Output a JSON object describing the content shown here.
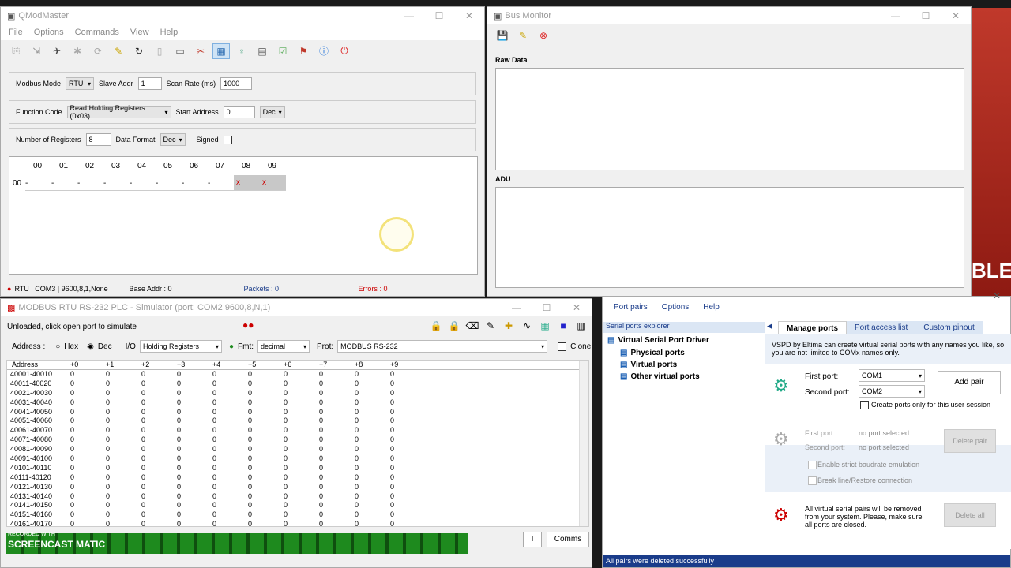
{
  "qmod": {
    "title": "QModMaster",
    "menu": [
      "File",
      "Options",
      "Commands",
      "View",
      "Help"
    ],
    "modbus_mode_label": "Modbus Mode",
    "modbus_mode": "RTU",
    "slave_addr_label": "Slave Addr",
    "slave_addr": "1",
    "scan_rate_label": "Scan Rate (ms)",
    "scan_rate": "1000",
    "function_code_label": "Function Code",
    "function_code": "Read Holding Registers (0x03)",
    "start_address_label": "Start Address",
    "start_address": "0",
    "start_format": "Dec",
    "num_regs_label": "Number of Registers",
    "num_regs": "8",
    "data_format_label": "Data Format",
    "data_format": "Dec",
    "signed_label": "Signed",
    "columns": [
      "00",
      "01",
      "02",
      "03",
      "04",
      "05",
      "06",
      "07",
      "08",
      "09"
    ],
    "row_label": "00",
    "values": [
      "-",
      "-",
      "-",
      "-",
      "-",
      "-",
      "-",
      "-",
      "x",
      "x"
    ],
    "status_conn": "RTU : COM3 | 9600,8,1,None",
    "status_base": "Base Addr : 0",
    "status_packets": "Packets : 0",
    "status_errors": "Errors : 0"
  },
  "bus": {
    "title": "Bus Monitor",
    "raw_label": "Raw Data",
    "adu_label": "ADU"
  },
  "sim": {
    "title": "MODBUS RTU RS-232 PLC - Simulator (port: COM2 9600,8,N,1)",
    "status": "Unloaded, click open port to simulate",
    "address_label": "Address :",
    "hex_label": "Hex",
    "dec_label": "Dec",
    "io_label": "I/O",
    "io_value": "Holding Registers",
    "fmt_label": "Fmt:",
    "fmt_value": "decimal",
    "prot_label": "Prot:",
    "prot_value": "MODBUS RS-232",
    "clone_label": "Clone",
    "headers": [
      "Address",
      "+0",
      "+1",
      "+2",
      "+3",
      "+4",
      "+5",
      "+6",
      "+7",
      "+8",
      "+9"
    ],
    "rows": [
      "40001-40010",
      "40011-40020",
      "40021-40030",
      "40031-40040",
      "40041-40050",
      "40051-40060",
      "40061-40070",
      "40071-40080",
      "40081-40090",
      "40091-40100",
      "40101-40110",
      "40111-40120",
      "40121-40130",
      "40131-40140",
      "40141-40150",
      "40151-40160",
      "40161-40170"
    ],
    "zero": "0",
    "t_button": "T",
    "comms_button": "Comms",
    "watermark_top": "RECORDED WITH",
    "watermark": "SCREENCAST MATIC"
  },
  "vspd": {
    "menu": [
      "Port pairs",
      "Options",
      "Help"
    ],
    "explorer_label": "Serial ports explorer",
    "root": "Virtual Serial Port Driver",
    "nodes": [
      "Physical ports",
      "Virtual ports",
      "Other virtual ports"
    ],
    "tabs": [
      "Manage ports",
      "Port access list",
      "Custom pinout"
    ],
    "desc": "VSPD by Eltima can create virtual serial ports with any names you like, so you are not limited to COMx names only.",
    "first_port_label": "First port:",
    "first_port": "COM1",
    "second_port_label": "Second port:",
    "second_port": "COM2",
    "add_pair": "Add pair",
    "create_only_label": "Create ports only for this user session",
    "first_port_none": "no port selected",
    "second_port_none": "no port selected",
    "delete_pair": "Delete pair",
    "strict_label": "Enable strict baudrate emulation",
    "break_label": "Break line/Restore connection",
    "delete_all_text": "All virtual serial pairs will be removed from your system. Please, make sure all ports are closed.",
    "delete_all": "Delete all",
    "status": "All pairs were deleted successfully"
  },
  "side_text": "BLE",
  "colors": {
    "accent": "#1a3c8a",
    "red": "#cc0000",
    "green": "#1e8a1e",
    "selected_cell": "#c8c8c8"
  }
}
